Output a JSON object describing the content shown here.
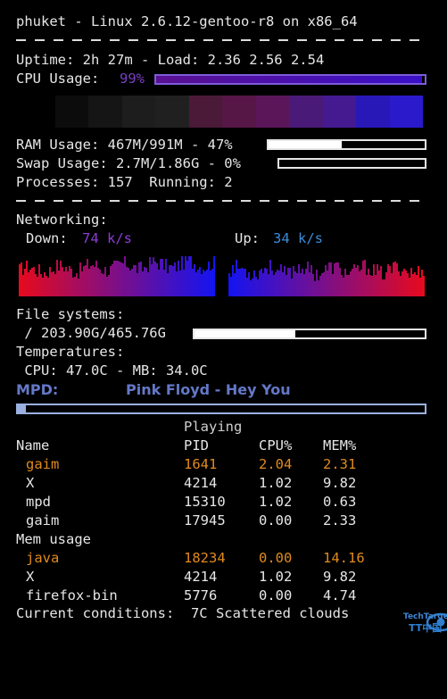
{
  "header": {
    "title": "phuket - Linux 2.6.12-gentoo-r8 on x86_64"
  },
  "system": {
    "uptime_line": "Uptime: 2h 27m - Load: 2.36 2.56 2.54",
    "cpu_label": "CPU Usage:",
    "cpu_value": "99%",
    "cpu_percent": 99,
    "ram_line": "RAM Usage: 467M/991M - 47%",
    "ram_percent": 47,
    "swap_line": "Swap Usage: 2.7M/1.86G - 0%",
    "swap_percent": 0,
    "processes_line": "Processes: 157  Running: 2"
  },
  "cpu_history": [
    {
      "level": 0.6,
      "color": "#0c0c0c"
    },
    {
      "level": 0.6,
      "color": "#151515"
    },
    {
      "level": 0.6,
      "color": "#1d1d1d"
    },
    {
      "level": 0.6,
      "color": "#202020"
    },
    {
      "level": 0.6,
      "color": "#4a1a38"
    },
    {
      "level": 0.6,
      "color": "#561646"
    },
    {
      "level": 0.6,
      "color": "#5a1658"
    },
    {
      "level": 0.6,
      "color": "#4a1a78"
    },
    {
      "level": 0.6,
      "color": "#451a90"
    },
    {
      "level": 0.6,
      "color": "#2818b8"
    },
    {
      "level": 0.6,
      "color": "#2a1acc"
    }
  ],
  "networking": {
    "heading": "Networking:",
    "down_label": "Down:",
    "down_value": "74 k/s",
    "up_label": "Up:",
    "up_value": "34 k/s",
    "down_color": "#8c3cd8",
    "up_color": "#3c8cd8"
  },
  "filesystems": {
    "heading": "File systems:",
    "root_line": " / 203.90G/465.76G",
    "root_percent": 43.8
  },
  "temperatures": {
    "heading": "Temperatures:",
    "line": " CPU: 47.0C - MB: 34.0C"
  },
  "mpd": {
    "label": "MPD:",
    "track": "Pink Floyd - Hey You",
    "status": "Playing",
    "progress": 0.02
  },
  "cpu_table": {
    "headers": [
      "Name",
      "PID",
      "CPU%",
      "MEM%"
    ],
    "rows": [
      {
        "name": "gaim",
        "pid": "1641",
        "cpu": "2.04",
        "mem": "2.31",
        "highlight": true
      },
      {
        "name": "X",
        "pid": "4214",
        "cpu": "1.02",
        "mem": "9.82",
        "highlight": false
      },
      {
        "name": "mpd",
        "pid": "15310",
        "cpu": "1.02",
        "mem": "0.63",
        "highlight": false
      },
      {
        "name": "gaim",
        "pid": "17945",
        "cpu": "0.00",
        "mem": "2.33",
        "highlight": false
      }
    ]
  },
  "mem_table": {
    "heading": "Mem usage",
    "rows": [
      {
        "name": "java",
        "pid": "18234",
        "cpu": "0.00",
        "mem": "14.16",
        "highlight": true
      },
      {
        "name": "X",
        "pid": "4214",
        "cpu": "1.02",
        "mem": "9.82",
        "highlight": false
      },
      {
        "name": "firefox-bin",
        "pid": "5776",
        "cpu": "0.00",
        "mem": "4.74",
        "highlight": false
      }
    ]
  },
  "weather": {
    "line": "Current conditions:  7C Scattered clouds"
  },
  "watermark": {
    "brand": "TechTarget",
    "sub": "TT中国"
  },
  "colors": {
    "accent_orange": "#e08a1e",
    "highlight_white": "#ffffff"
  }
}
